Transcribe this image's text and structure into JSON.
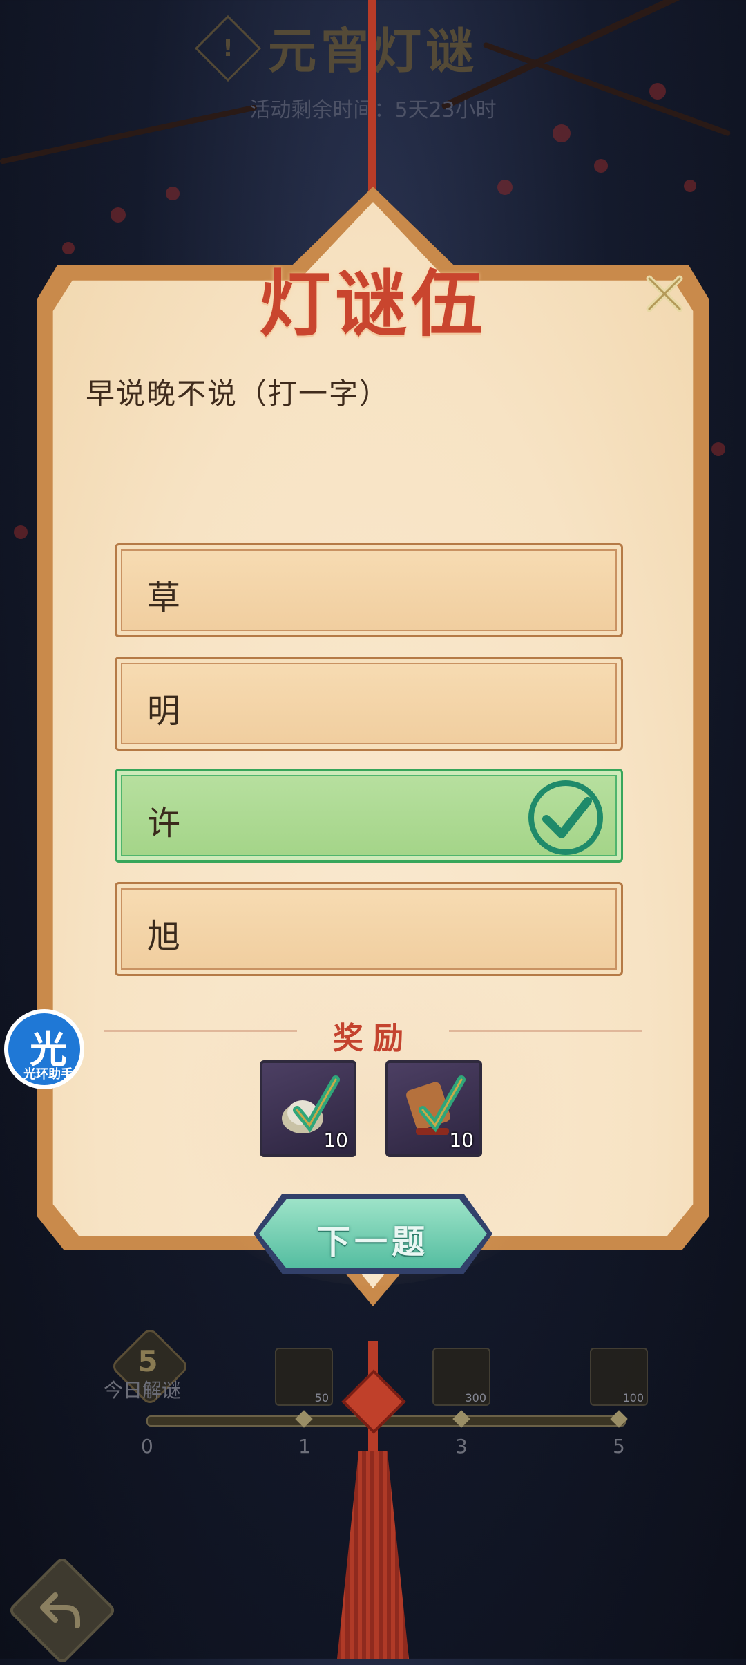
{
  "header": {
    "title": "元宵灯谜",
    "icon": "exclamation-icon",
    "remaining_time": "活动剩余时间：5天23小时"
  },
  "panel": {
    "title": "灯谜伍",
    "riddle": "早说晚不说（打一字）",
    "options": [
      {
        "label": "草",
        "state": "normal"
      },
      {
        "label": "明",
        "state": "normal"
      },
      {
        "label": "许",
        "state": "correct"
      },
      {
        "label": "旭",
        "state": "normal"
      }
    ],
    "reward_title": "奖励",
    "rewards": [
      {
        "icon": "silver-ingot-item-icon",
        "count": "10"
      },
      {
        "icon": "scroll-item-icon",
        "count": "10"
      }
    ],
    "next_button": "下一题"
  },
  "progress": {
    "solved_today": "5",
    "solved_label": "今日解谜",
    "ticks": [
      "0",
      "1",
      "3",
      "5"
    ],
    "milestones": [
      {
        "icon": "reward-chest-icon",
        "count": "50"
      },
      {
        "icon": "reward-ingot-icon",
        "count": "300"
      },
      {
        "icon": "reward-scroll-icon",
        "count": "100"
      }
    ]
  },
  "helper": {
    "char": "光",
    "label": "光环助手"
  },
  "colors": {
    "accent_red": "#c9452e",
    "correct_green": "#37a65a",
    "panel_parchment": "#f7e3c4",
    "panel_frame": "#c98a4b",
    "next_button_teal": "#54bda0"
  }
}
